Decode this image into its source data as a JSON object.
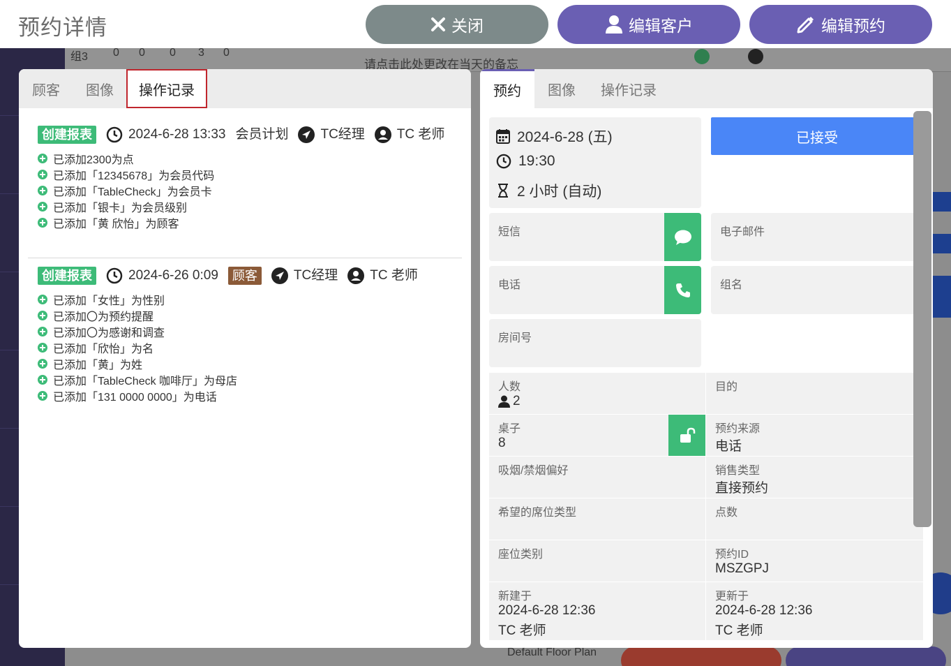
{
  "header": {
    "title": "预约详情",
    "close_label": "关闭",
    "edit_customer_label": "编辑客户",
    "edit_reservation_label": "编辑预约"
  },
  "background": {
    "stat_group": "组3",
    "stat_web": "0",
    "stat_walk": "0",
    "stat_list": "0",
    "stat_people": "3",
    "stat_chair": "0",
    "memo": "请点击此处更改在当天的备忘",
    "floor_plan": "Default Floor Plan"
  },
  "left_tabs": [
    "顾客",
    "图像",
    "操作记录"
  ],
  "history": [
    {
      "badge": "创建报表",
      "datetime": "2024-6-28 13:33",
      "plan": "会员计划",
      "manager": "TC经理",
      "staff": "TC 老师",
      "lines": [
        "已添加2300为点",
        "已添加「12345678」为会员代码",
        "已添加「TableCheck」为会员卡",
        "已添加「银卡」为会员级别",
        "已添加「黄 欣怡」为顾客"
      ]
    },
    {
      "badge": "创建报表",
      "datetime": "2024-6-26 0:09",
      "tag": "顾客",
      "manager": "TC经理",
      "staff": "TC 老师",
      "lines": [
        "已添加「女性」为性别",
        "已添加〇为预约提醒",
        "已添加〇为感谢和调查",
        "已添加「欣怡」为名",
        "已添加「黄」为姓",
        "已添加「TableCheck 咖啡厅」为母店",
        "已添加「131 0000 0000」为电话"
      ]
    }
  ],
  "right_tabs": [
    "预约",
    "图像",
    "操作记录"
  ],
  "reservation": {
    "date": "2024-6-28 (五)",
    "time": "19:30",
    "duration": "2 小时 (自动)",
    "status": "已接受",
    "sms_label": "短信",
    "email_label": "电子邮件",
    "phone_label": "电话",
    "group_label": "组名",
    "room_label": "房间号",
    "guests_label": "人数",
    "guests_value": "2",
    "purpose_label": "目的",
    "table_label": "桌子",
    "table_value": "8",
    "source_label": "预约来源",
    "source_value": "电话",
    "smoking_label": "吸烟/禁烟偏好",
    "sales_type_label": "销售类型",
    "sales_type_value": "直接预约",
    "seat_pref_label": "希望的席位类型",
    "points_label": "点数",
    "seat_category_label": "座位类别",
    "reservation_id_label": "预约ID",
    "reservation_id_value": "MSZGPJ",
    "created_label": "新建于",
    "created_at": "2024-6-28 12:36",
    "created_by": "TC 老师",
    "updated_label": "更新于",
    "updated_at": "2024-6-28 12:36",
    "updated_by": "TC 老师"
  },
  "colors": {
    "green": "#3dbb78",
    "purple": "#6a5fb3",
    "blue": "#4a86f7",
    "close_gray": "#7d8a8a",
    "brown": "#8b5a38",
    "active_tab_outline": "#c0262d"
  }
}
